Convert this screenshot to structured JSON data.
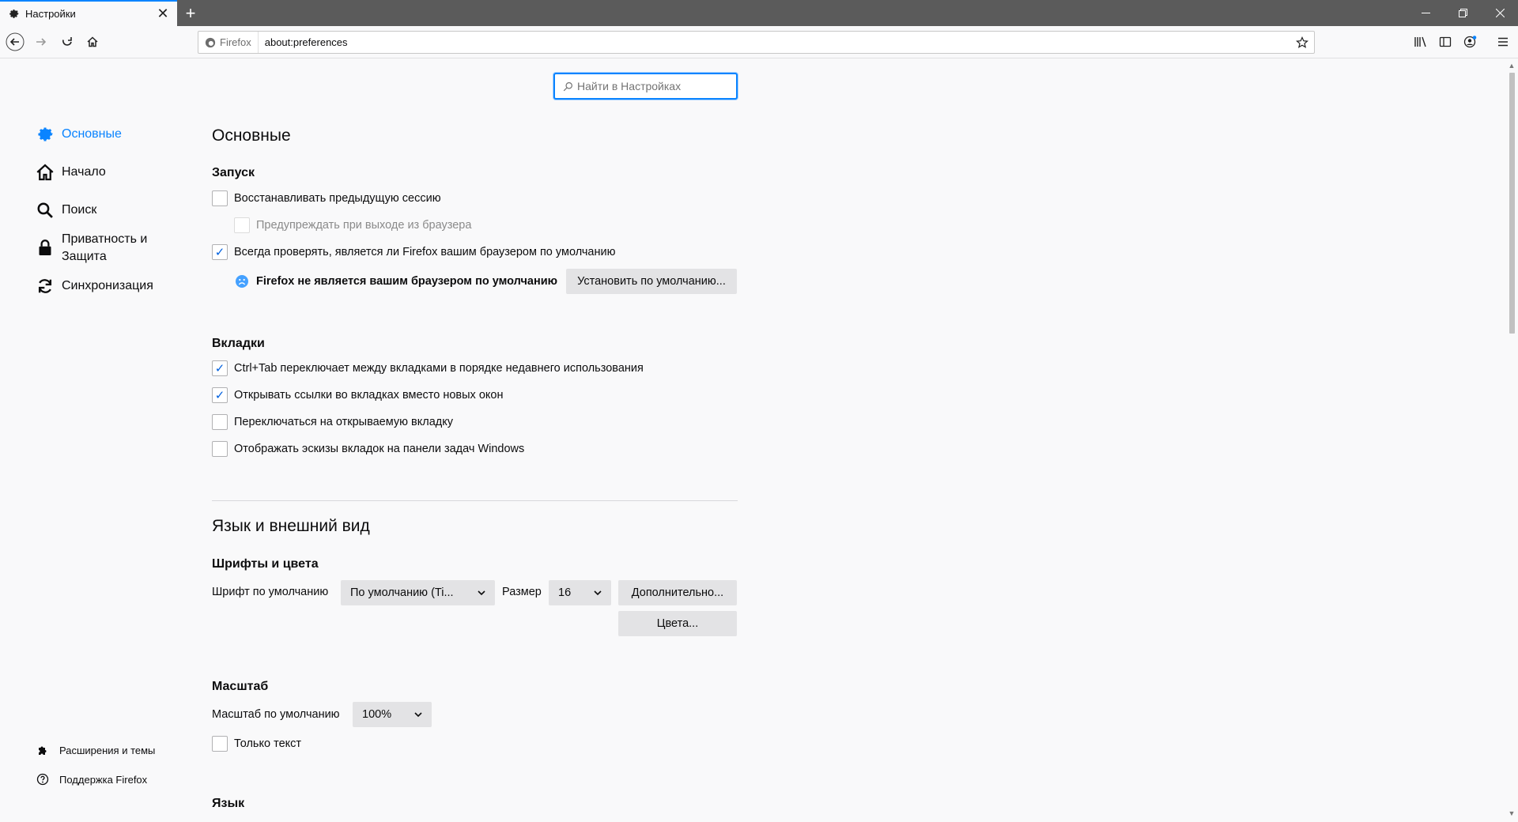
{
  "tab": {
    "title": "Настройки",
    "close": "✕"
  },
  "newtab": "+",
  "urlbar": {
    "identity": "Firefox",
    "url": "about:preferences"
  },
  "search": {
    "placeholder": "Найти в Настройках"
  },
  "sidebar": {
    "items": [
      {
        "label": "Основные"
      },
      {
        "label": "Начало"
      },
      {
        "label": "Поиск"
      },
      {
        "label": "Приватность и Защита"
      },
      {
        "label": "Синхронизация"
      }
    ],
    "footer": [
      {
        "label": "Расширения и темы"
      },
      {
        "label": "Поддержка Firefox"
      }
    ]
  },
  "main": {
    "title": "Основные",
    "startup": {
      "heading": "Запуск",
      "restore_session": "Восстанавливать предыдущую сессию",
      "warn_on_quit": "Предупреждать при выходе из браузера",
      "check_default": "Всегда проверять, является ли Firefox вашим браузером по умолчанию",
      "not_default": "Firefox не является вашим браузером по умолчанию",
      "set_default_button": "Установить по умолчанию..."
    },
    "tabs": {
      "heading": "Вкладки",
      "ctrl_tab": "Ctrl+Tab переключает между вкладками в порядке недавнего использования",
      "open_links_tabs": "Открывать ссылки во вкладках вместо новых окон",
      "switch_to_tab": "Переключаться на открываемую вкладку",
      "taskbar_previews": "Отображать эскизы вкладок на панели задач Windows"
    },
    "language_appearance": {
      "title": "Язык и внешний вид",
      "fonts_heading": "Шрифты и цвета",
      "default_font_label": "Шрифт по умолчанию",
      "default_font_value": "По умолчанию (Ti...",
      "size_label": "Размер",
      "size_value": "16",
      "advanced_button": "Дополнительно...",
      "colors_button": "Цвета..."
    },
    "zoom": {
      "heading": "Масштаб",
      "default_zoom_label": "Масштаб по умолчанию",
      "default_zoom_value": "100%",
      "text_only": "Только текст"
    },
    "language": {
      "heading": "Язык"
    }
  },
  "checkmark": "✓",
  "colors": {
    "accent": "#0a84ff",
    "titlebar": "#5b5b5b",
    "background": "#f9f9fa"
  }
}
